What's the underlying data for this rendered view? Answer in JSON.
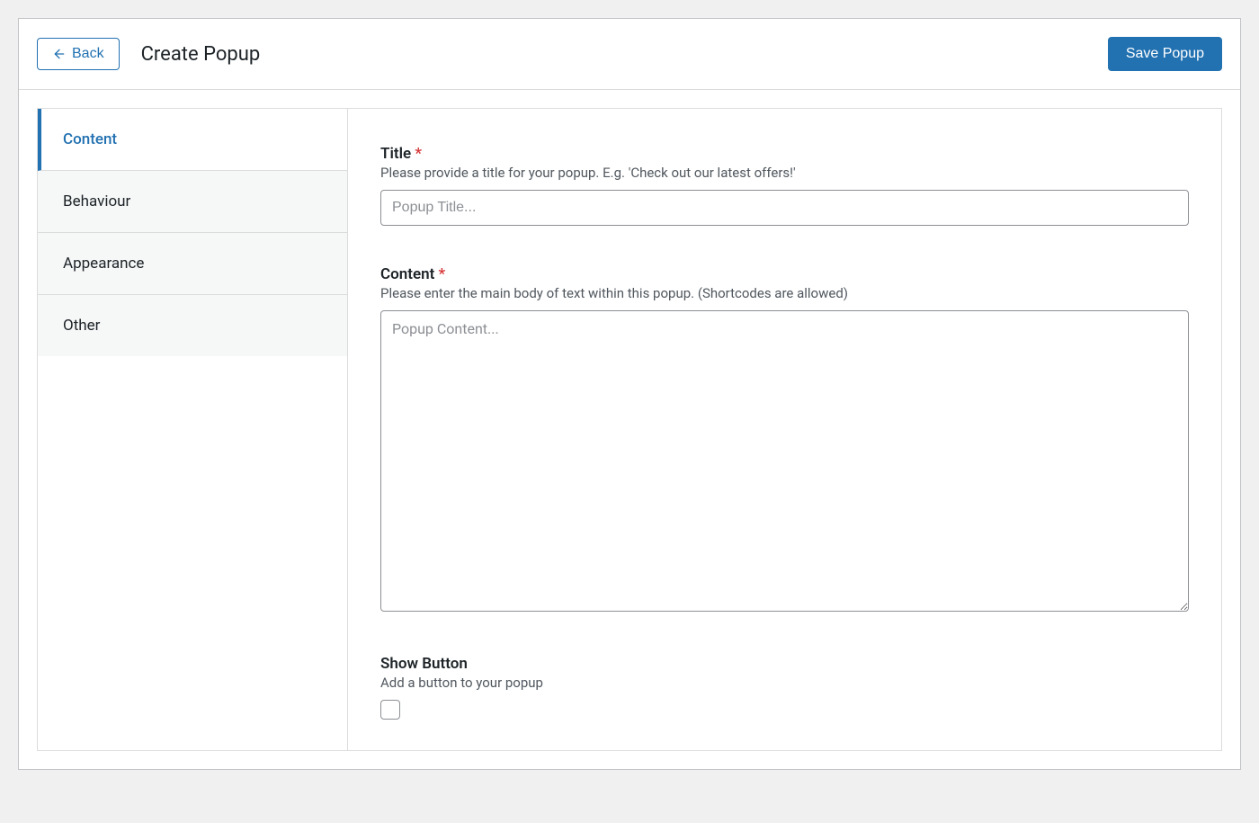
{
  "header": {
    "back_label": "Back",
    "page_title": "Create Popup",
    "save_label": "Save Popup"
  },
  "sidebar": {
    "tabs": [
      {
        "label": "Content",
        "active": true
      },
      {
        "label": "Behaviour",
        "active": false
      },
      {
        "label": "Appearance",
        "active": false
      },
      {
        "label": "Other",
        "active": false
      }
    ]
  },
  "form": {
    "title": {
      "label": "Title",
      "required_mark": "*",
      "description": "Please provide a title for your popup. E.g. 'Check out our latest offers!'",
      "placeholder": "Popup Title...",
      "value": ""
    },
    "content": {
      "label": "Content",
      "required_mark": "*",
      "description": "Please enter the main body of text within this popup. (Shortcodes are allowed)",
      "placeholder": "Popup Content...",
      "value": ""
    },
    "show_button": {
      "label": "Show Button",
      "description": "Add a button to your popup",
      "checked": false
    }
  }
}
